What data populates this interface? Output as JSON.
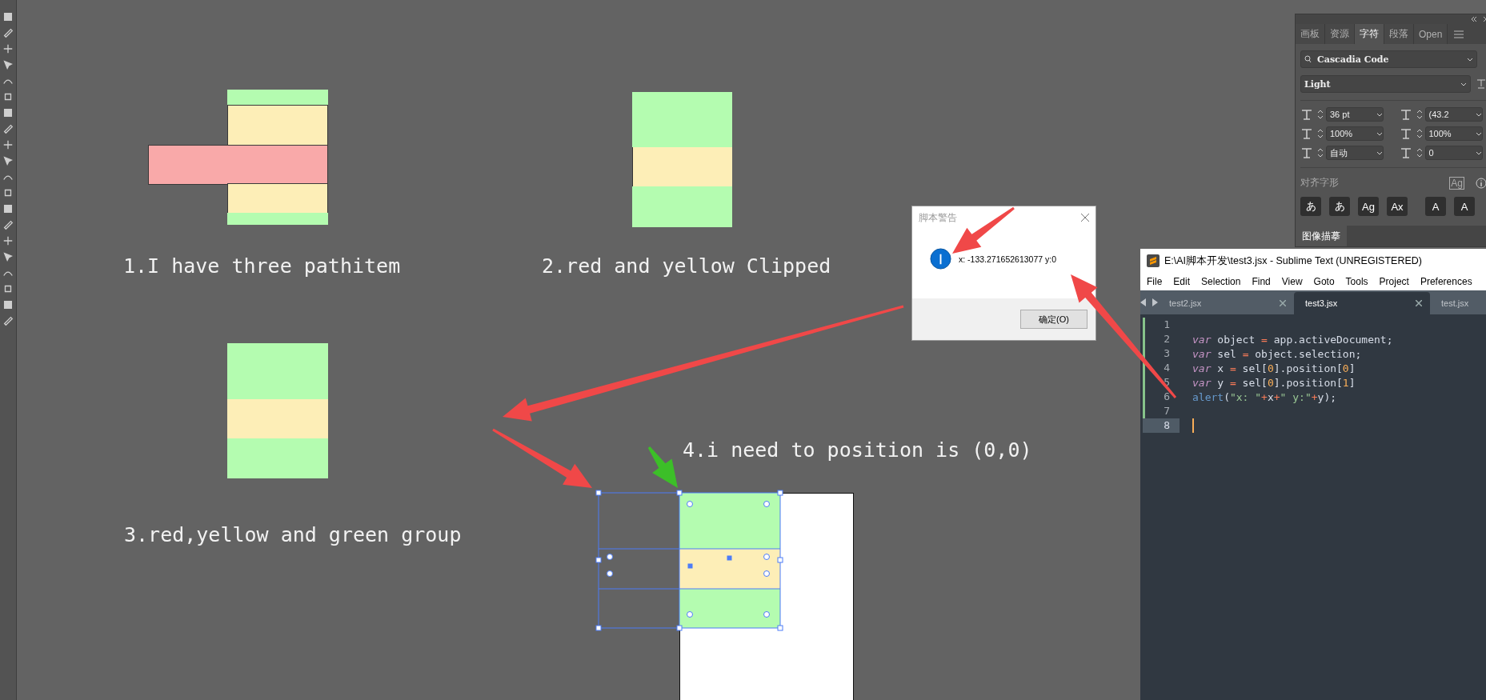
{
  "canvas": {
    "labels": [
      "1.I have three pathitem",
      "2.red and yellow Clipped",
      "3.red,yellow and green group",
      "4.i need to position is (0,0)"
    ]
  },
  "panel": {
    "tabs": [
      {
        "label": "画板",
        "selected": false
      },
      {
        "label": "资源",
        "selected": false
      },
      {
        "label": "字符",
        "selected": true
      },
      {
        "label": "段落",
        "selected": false
      },
      {
        "label": "Open",
        "selected": false
      }
    ],
    "font_family": "Cascadia Code",
    "font_style": "Light",
    "fields": [
      "36 pt",
      "(43.2",
      "100%",
      "100%",
      "自动",
      "0"
    ],
    "section": "对齐字形",
    "section_icon": "Ag",
    "glyph_buttons": [
      "あ",
      "あ",
      "Ag",
      "Ax",
      "A",
      "A"
    ],
    "bottom_tab": "图像描摹"
  },
  "dialog": {
    "title": "脚本警告",
    "message": "x: -133.271652613077 y:0",
    "button": "确定(O)"
  },
  "editor": {
    "title": "E:\\AI脚本开发\\test3.jsx - Sublime Text (UNREGISTERED)",
    "menu": [
      "File",
      "Edit",
      "Selection",
      "Find",
      "View",
      "Goto",
      "Tools",
      "Project",
      "Preferences"
    ],
    "tabs": [
      {
        "label": "test2.jsx",
        "selected": false
      },
      {
        "label": "test3.jsx",
        "selected": true
      },
      {
        "label": "test.jsx",
        "selected": false
      }
    ],
    "lines": [
      {
        "number": "1",
        "current": false
      },
      {
        "number": "2",
        "current": false,
        "tokens": [
          {
            "kind": "keyword",
            "text": "var"
          },
          {
            "kind": "plain",
            "text": " object "
          },
          {
            "kind": "operator",
            "text": "="
          },
          {
            "kind": "plain",
            "text": " app.activeDocument;"
          }
        ]
      },
      {
        "number": "3",
        "current": false,
        "tokens": [
          {
            "kind": "keyword",
            "text": "var"
          },
          {
            "kind": "plain",
            "text": " sel "
          },
          {
            "kind": "operator",
            "text": "="
          },
          {
            "kind": "plain",
            "text": " object.selection;"
          }
        ]
      },
      {
        "number": "4",
        "current": false,
        "tokens": [
          {
            "kind": "keyword",
            "text": "var"
          },
          {
            "kind": "plain",
            "text": " x "
          },
          {
            "kind": "operator",
            "text": "="
          },
          {
            "kind": "plain",
            "text": " sel["
          },
          {
            "kind": "number",
            "text": "0"
          },
          {
            "kind": "plain",
            "text": "].position["
          },
          {
            "kind": "number",
            "text": "0"
          },
          {
            "kind": "plain",
            "text": "]"
          }
        ]
      },
      {
        "number": "5",
        "current": false,
        "tokens": [
          {
            "kind": "keyword",
            "text": "var"
          },
          {
            "kind": "plain",
            "text": " y "
          },
          {
            "kind": "operator",
            "text": "="
          },
          {
            "kind": "plain",
            "text": " sel["
          },
          {
            "kind": "number",
            "text": "0"
          },
          {
            "kind": "plain",
            "text": "].position["
          },
          {
            "kind": "number",
            "text": "1"
          },
          {
            "kind": "plain",
            "text": "]"
          }
        ]
      },
      {
        "number": "6",
        "current": false,
        "tokens": [
          {
            "kind": "function",
            "text": "alert"
          },
          {
            "kind": "plain",
            "text": "("
          },
          {
            "kind": "string",
            "text": "\"x: \""
          },
          {
            "kind": "operator",
            "text": "+"
          },
          {
            "kind": "plain",
            "text": "x"
          },
          {
            "kind": "operator",
            "text": "+"
          },
          {
            "kind": "string",
            "text": "\" y:\""
          },
          {
            "kind": "operator",
            "text": "+"
          },
          {
            "kind": "plain",
            "text": "y);"
          }
        ]
      },
      {
        "number": "7",
        "current": false
      },
      {
        "number": "8",
        "current": true
      }
    ]
  }
}
